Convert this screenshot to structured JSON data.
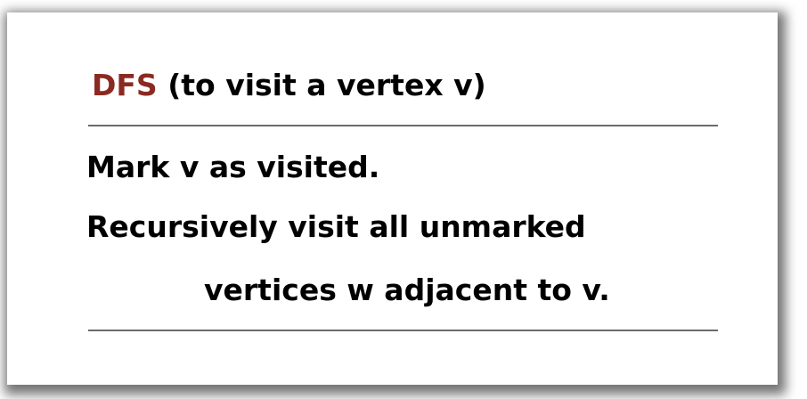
{
  "algorithm": {
    "keyword": "DFS",
    "subtitle": "(to visit a vertex v)",
    "steps": [
      "Mark v as visited.",
      "Recursively visit all unmarked",
      "vertices w adjacent to v."
    ]
  },
  "colors": {
    "keyword": "#8b2a22",
    "text": "#000000",
    "rule": "#6b6b6b"
  }
}
